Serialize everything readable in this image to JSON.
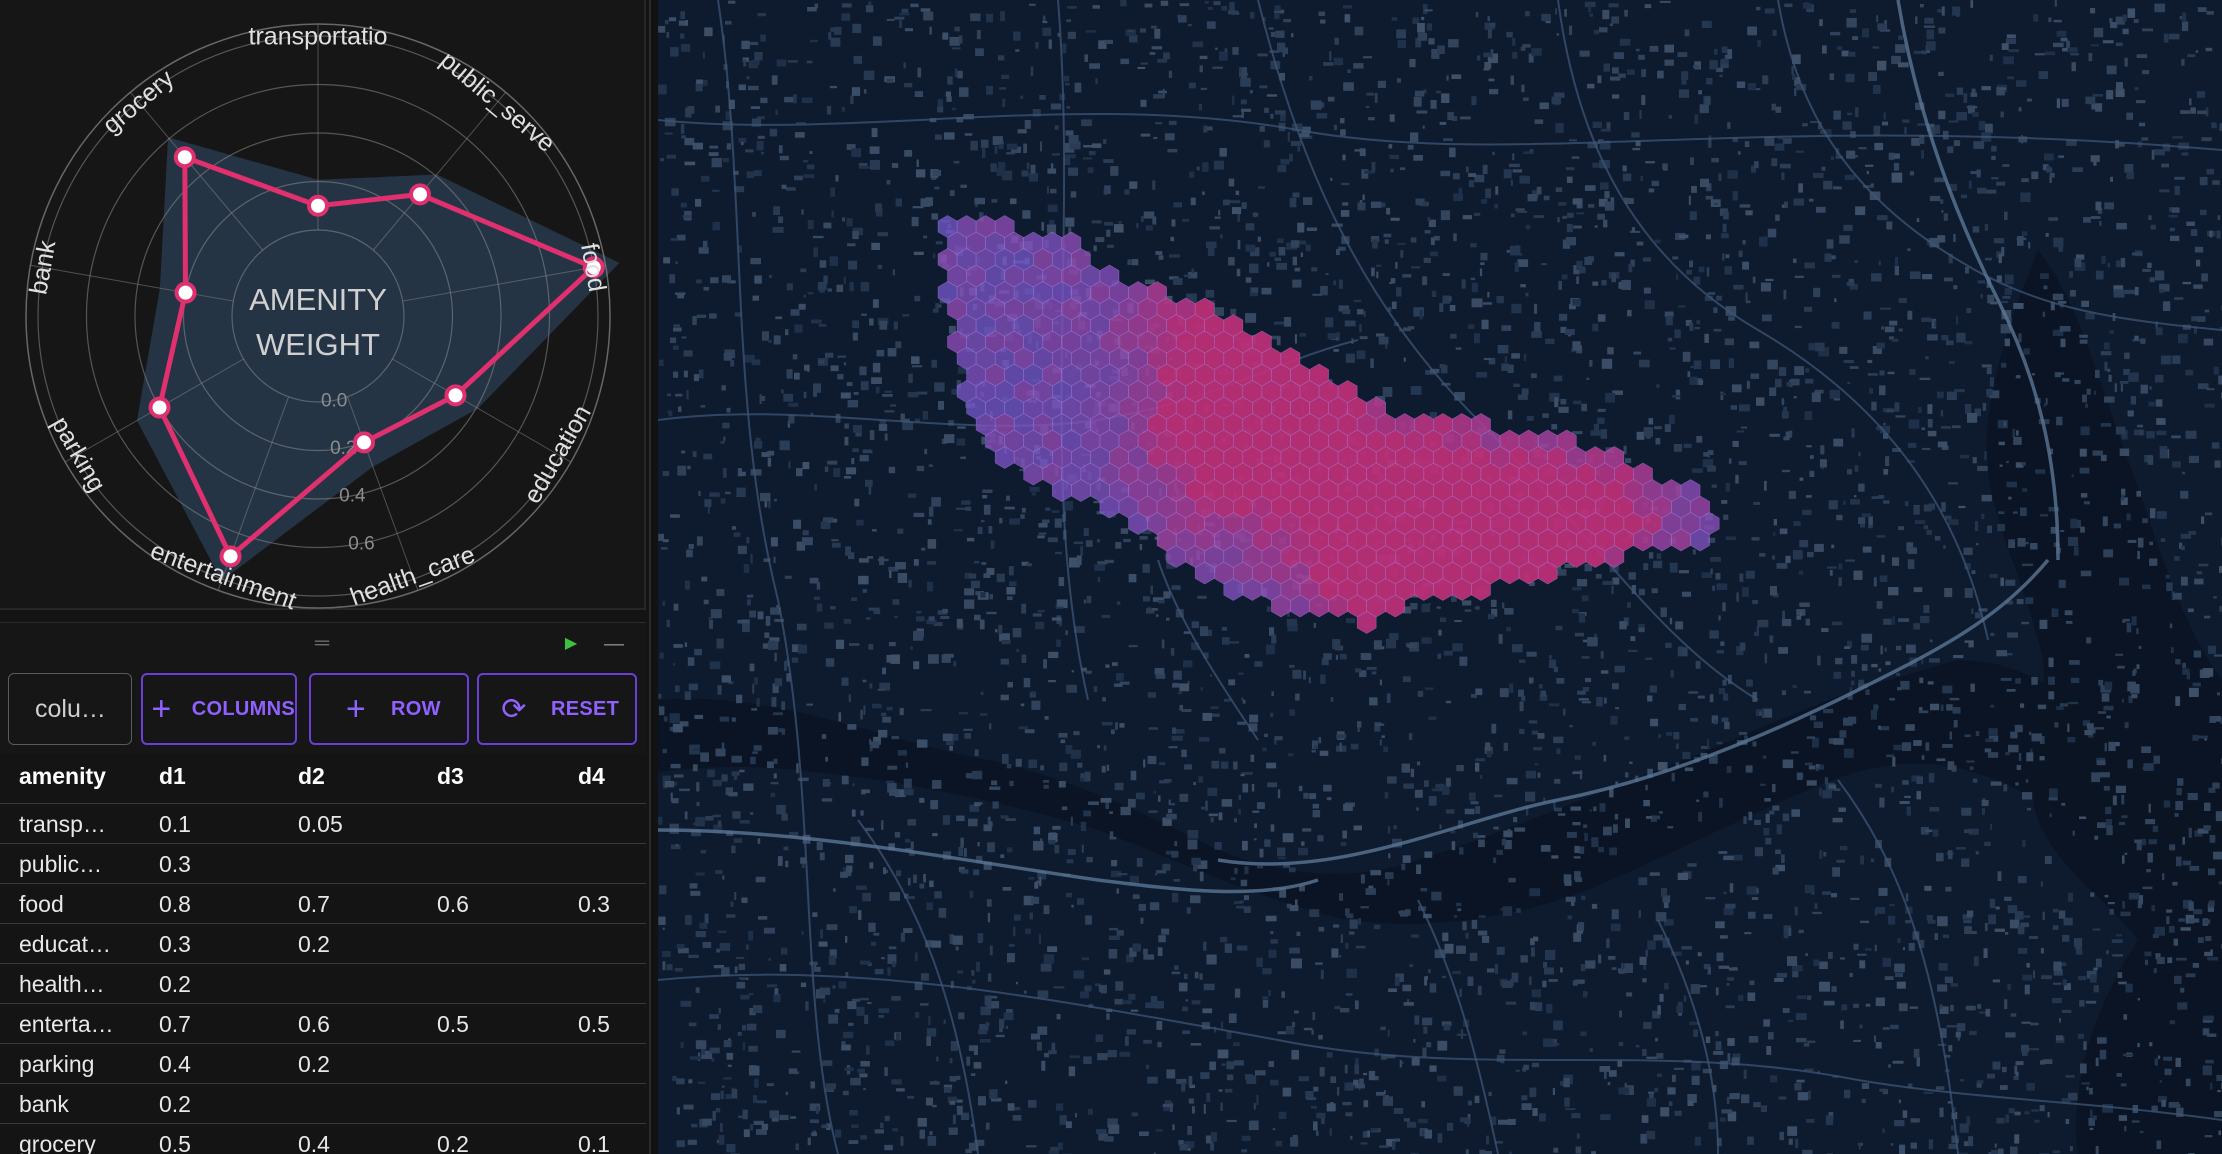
{
  "chart_data": {
    "type": "radar",
    "center_label": [
      "AMENITY",
      "WEIGHT"
    ],
    "axes": [
      "transportation",
      "public_service",
      "food",
      "education",
      "health_care",
      "entertainment",
      "parking",
      "bank",
      "grocery"
    ],
    "axis_labels": [
      "transportatio",
      "public_serve",
      "food",
      "education",
      "health_care",
      "entertainment",
      "parking",
      "bank",
      "grocery"
    ],
    "radial_ticks": [
      "0.0",
      "0.2",
      "0.4",
      "0.6"
    ],
    "rmax": 0.8,
    "series": [
      {
        "values": [
          0.1,
          0.3,
          0.8,
          0.3,
          0.2,
          0.7,
          0.4,
          0.2,
          0.5
        ]
      }
    ],
    "band": {
      "max": [
        0.1,
        0.3,
        0.8,
        0.3,
        0.2,
        0.7,
        0.4,
        0.2,
        0.5
      ]
    },
    "colors": {
      "line": "#e0306e",
      "band": "#2b3f55",
      "grid": "#8a8a8a",
      "text": "#e0e0e0"
    }
  },
  "panel": {
    "handle_icon": "drag-handle-icon",
    "play_icon": "play-icon",
    "minimize_icon": "minimize-icon"
  },
  "toolbar": {
    "column_input_value": "colu…",
    "columns_label": "COLUMNS",
    "row_label": "ROW",
    "reset_label": "RESET",
    "accent": "#6a3fd6"
  },
  "table": {
    "headers": [
      "amenity",
      "d1",
      "d2",
      "d3",
      "d4"
    ],
    "rows": [
      [
        "transp…",
        "0.1",
        "0.05",
        "",
        ""
      ],
      [
        "public…",
        "0.3",
        "",
        "",
        ""
      ],
      [
        "food",
        "0.8",
        "0.7",
        "0.6",
        "0.3"
      ],
      [
        "educat…",
        "0.3",
        "0.2",
        "",
        ""
      ],
      [
        "health…",
        "0.2",
        "",
        "",
        ""
      ],
      [
        "enterta…",
        "0.7",
        "0.6",
        "0.5",
        "0.5"
      ],
      [
        "parking",
        "0.4",
        "0.2",
        "",
        ""
      ],
      [
        "bank",
        "0.2",
        "",
        "",
        ""
      ],
      [
        "grocery",
        "0.5",
        "0.4",
        "0.2",
        "0.1"
      ]
    ]
  },
  "map": {
    "base_color": "#0e1a2e",
    "hex_base_color": "#7b5bd6",
    "hex_hot_color": "#c0307a"
  }
}
